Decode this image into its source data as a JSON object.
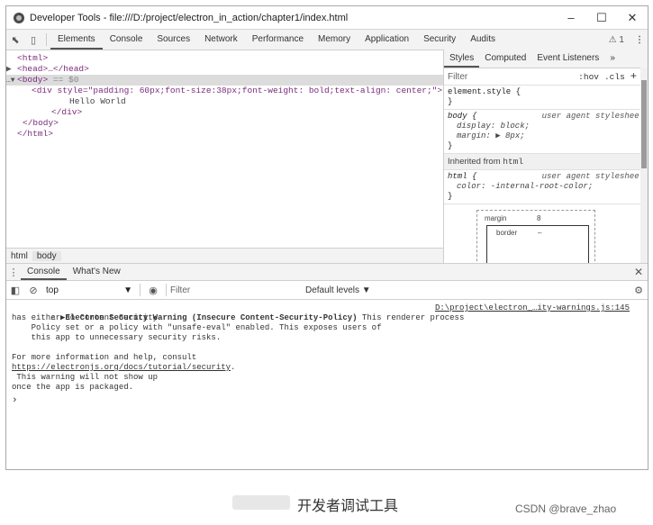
{
  "window": {
    "title": "Developer Tools - file:///D:/project/electron_in_action/chapter1/index.html",
    "controls": [
      "–",
      "☐",
      "✕"
    ]
  },
  "toolbar": {
    "tabs": [
      "Elements",
      "Console",
      "Sources",
      "Network",
      "Performance",
      "Memory",
      "Application",
      "Security",
      "Audits"
    ],
    "active_tab": "Elements",
    "warning_count": "⚠ 1",
    "menu_icon": "⋮"
  },
  "elements": {
    "lines": [
      {
        "prefix": "",
        "text": "<html>"
      },
      {
        "prefix": "▶",
        "text": "<head>…</head>"
      },
      {
        "prefix": "…▼",
        "text": "<body>",
        "suffix": " == $0"
      },
      {
        "prefix": "",
        "text": "<div style=\"padding: 60px;font-size:38px;font-weight: bold;text-align: center;\">"
      },
      {
        "prefix": "",
        "text": "Hello World"
      },
      {
        "prefix": "",
        "text": "</div>"
      },
      {
        "prefix": "",
        "text": "</body>"
      },
      {
        "prefix": "",
        "text": "</html>"
      }
    ],
    "breadcrumbs": [
      "html",
      "body"
    ]
  },
  "styles_pane": {
    "tabs": [
      "Styles",
      "Computed",
      "Event Listeners",
      "»"
    ],
    "filter_placeholder": "Filter",
    "hov": ":hov",
    "cls": ".cls",
    "plus": "+",
    "element_style": "element.style {",
    "element_style_close": "}",
    "body_rule": {
      "selector": "body {",
      "origin": "user agent stylesheet",
      "props": [
        "display: block;",
        "margin: ▶ 8px;"
      ],
      "close": "}"
    },
    "inherited_label": "Inherited from",
    "inherited_from": "html",
    "html_rule": {
      "selector": "html {",
      "origin": "user agent stylesheet",
      "props": [
        "color: -internal-root-color;"
      ],
      "close": "}"
    },
    "box_model": {
      "margin_label": "margin",
      "margin_value": "8",
      "border_label": "border",
      "border_value": "–"
    }
  },
  "drawer": {
    "tabs": [
      "Console",
      "What's New"
    ],
    "active_tab": "Console",
    "context": "top",
    "filter_placeholder": "Filter",
    "levels": "Default levels ▼"
  },
  "console": {
    "warning": {
      "title": "▶Electron Security Warning (Insecure Content-Security-Policy)",
      "title_rest": " This renderer process",
      "source": "D:\\project\\electron_…ity-warnings.js:145",
      "lines": [
        "has either no Content Security",
        "    Policy set or a policy with \"unsafe-eval\" enabled. This exposes users of",
        "    this app to unnecessary security risks.",
        "",
        "For more information and help, consult"
      ],
      "link": "https://electronjs.org/docs/tutorial/security",
      "after_link": ".",
      "tail": [
        " This warning will not show up",
        "once the app is packaged."
      ]
    },
    "prompt": "›"
  },
  "caption": {
    "text": "开发者调试工具",
    "watermark": "CSDN @brave_zhao"
  }
}
